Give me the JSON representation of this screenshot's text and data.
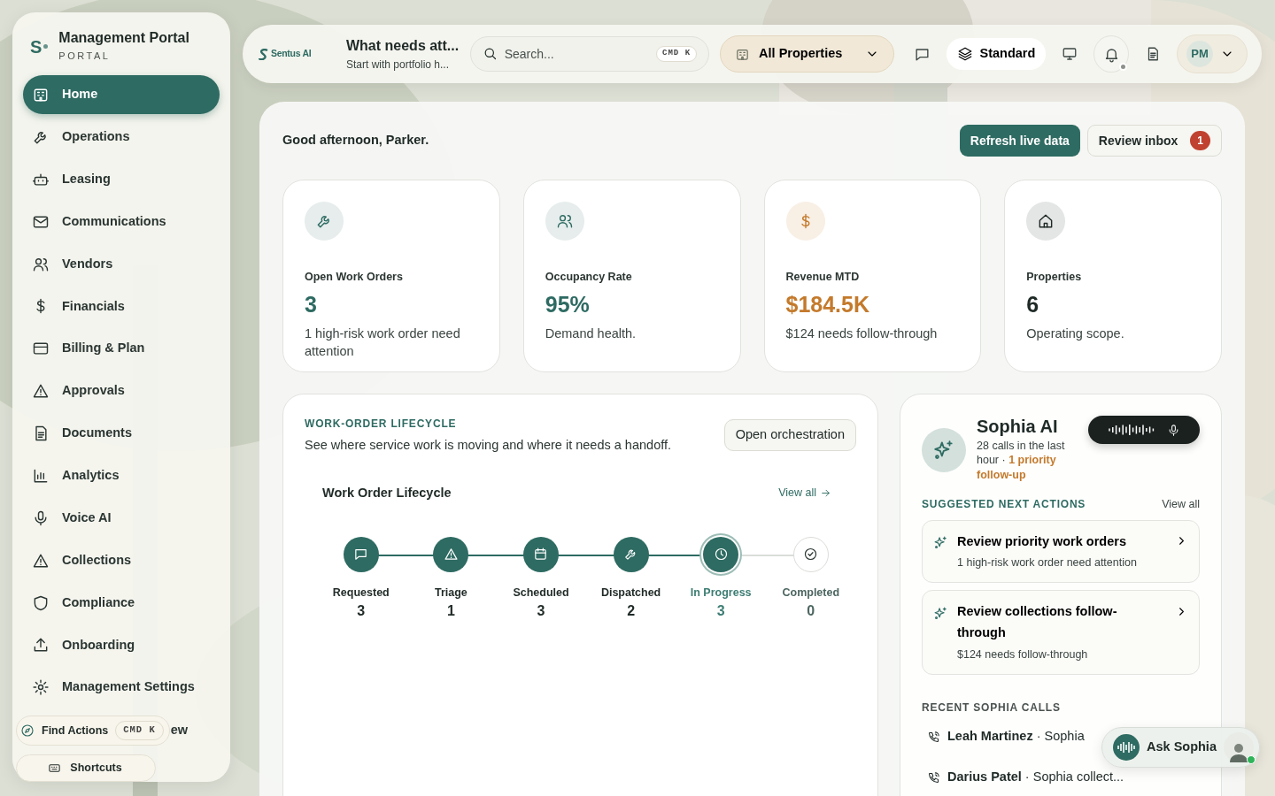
{
  "sidebar": {
    "logo_letter": "S",
    "title": "Management Portal",
    "subtitle": "PORTAL",
    "items": [
      {
        "label": "Home",
        "kind": "home",
        "selected": true
      },
      {
        "label": "Operations",
        "kind": "wrench",
        "selected": false
      },
      {
        "label": "Leasing",
        "kind": "bot",
        "selected": false
      },
      {
        "label": "Communications",
        "kind": "mail",
        "selected": false
      },
      {
        "label": "Vendors",
        "kind": "users",
        "selected": false
      },
      {
        "label": "Financials",
        "kind": "dollar",
        "selected": false
      },
      {
        "label": "Billing & Plan",
        "kind": "card",
        "selected": false
      },
      {
        "label": "Approvals",
        "kind": "alert",
        "selected": false
      },
      {
        "label": "Documents",
        "kind": "doc",
        "selected": false
      },
      {
        "label": "Analytics",
        "kind": "chart",
        "selected": false
      },
      {
        "label": "Voice AI",
        "kind": "mic",
        "selected": false
      },
      {
        "label": "Collections",
        "kind": "alert",
        "selected": false
      },
      {
        "label": "Compliance",
        "kind": "shield",
        "selected": false
      },
      {
        "label": "Onboarding",
        "kind": "upload",
        "selected": false
      },
      {
        "label": "Management Settings",
        "kind": "gear",
        "selected": false
      }
    ],
    "find_actions": {
      "label": "Find Actions",
      "shortcut": "CMD K"
    },
    "covered_text": "ew",
    "shortcuts": {
      "label": "Shortcuts"
    }
  },
  "header": {
    "brand": "Sentus AI",
    "title": "What needs att...",
    "subtitle": "Start with portfolio h...",
    "search": {
      "placeholder": "Search...",
      "shortcut": "CMD K"
    },
    "property_select": {
      "value": "All Properties"
    },
    "mode": {
      "label": "Standard"
    },
    "notifications": {
      "unread": true
    },
    "avatar": {
      "initials": "PM"
    }
  },
  "greeting": "Good afternoon, Parker.",
  "actions": {
    "refresh": "Refresh live data",
    "inbox": {
      "label": "Review inbox",
      "count": "1"
    }
  },
  "stats": [
    {
      "kind": "wrench",
      "label": "Open Work Orders",
      "value": "3",
      "note": "1 high-risk work order need attention",
      "color": "#2e6b62"
    },
    {
      "kind": "users",
      "label": "Occupancy Rate",
      "value": "95%",
      "note": "Demand health.",
      "color": "#2e6b62"
    },
    {
      "kind": "dollar",
      "label": "Revenue MTD",
      "value": "$184.5K",
      "note": "$124 needs follow-through",
      "color": "#c47a2c"
    },
    {
      "kind": "house",
      "label": "Properties",
      "value": "6",
      "note": "Operating scope.",
      "color": "#1f2a27"
    }
  ],
  "lifecycle": {
    "section_label": "WORK-ORDER LIFECYCLE",
    "description": "See where service work is moving and where it needs a handoff.",
    "button": "Open orchestration",
    "chart_title": "Work Order Lifecycle",
    "view_all": "View all",
    "stages": [
      {
        "label": "Requested",
        "count": "3",
        "kind": "chat",
        "done": true,
        "current": false
      },
      {
        "label": "Triage",
        "count": "1",
        "kind": "alert",
        "done": true,
        "current": false
      },
      {
        "label": "Scheduled",
        "count": "3",
        "kind": "calendar",
        "done": true,
        "current": false
      },
      {
        "label": "Dispatched",
        "count": "2",
        "kind": "wrench",
        "done": true,
        "current": false
      },
      {
        "label": "In Progress",
        "count": "3",
        "kind": "clock",
        "done": true,
        "current": true
      },
      {
        "label": "Completed",
        "count": "0",
        "kind": "check",
        "done": false,
        "current": false
      }
    ]
  },
  "sophia": {
    "name": "Sophia AI",
    "summary": "28 calls in the last hour",
    "separator": "·",
    "priority": "1 priority follow-up",
    "suggested_label": "SUGGESTED NEXT ACTIONS",
    "view_all": "View all",
    "suggestions": [
      {
        "title": "Review priority work orders",
        "detail": "1 high-risk work order need attention"
      },
      {
        "title": "Review collections follow-through",
        "detail": "$124 needs follow-through"
      }
    ],
    "recent_label": "RECENT SOPHIA CALLS",
    "calls": [
      {
        "text": "**Leah Martinez** · Sophia"
      },
      {
        "text": "**Darius Patel** · Sophia collect..."
      }
    ]
  },
  "ask_sophia": {
    "label": "Ask Sophia",
    "online": true
  }
}
